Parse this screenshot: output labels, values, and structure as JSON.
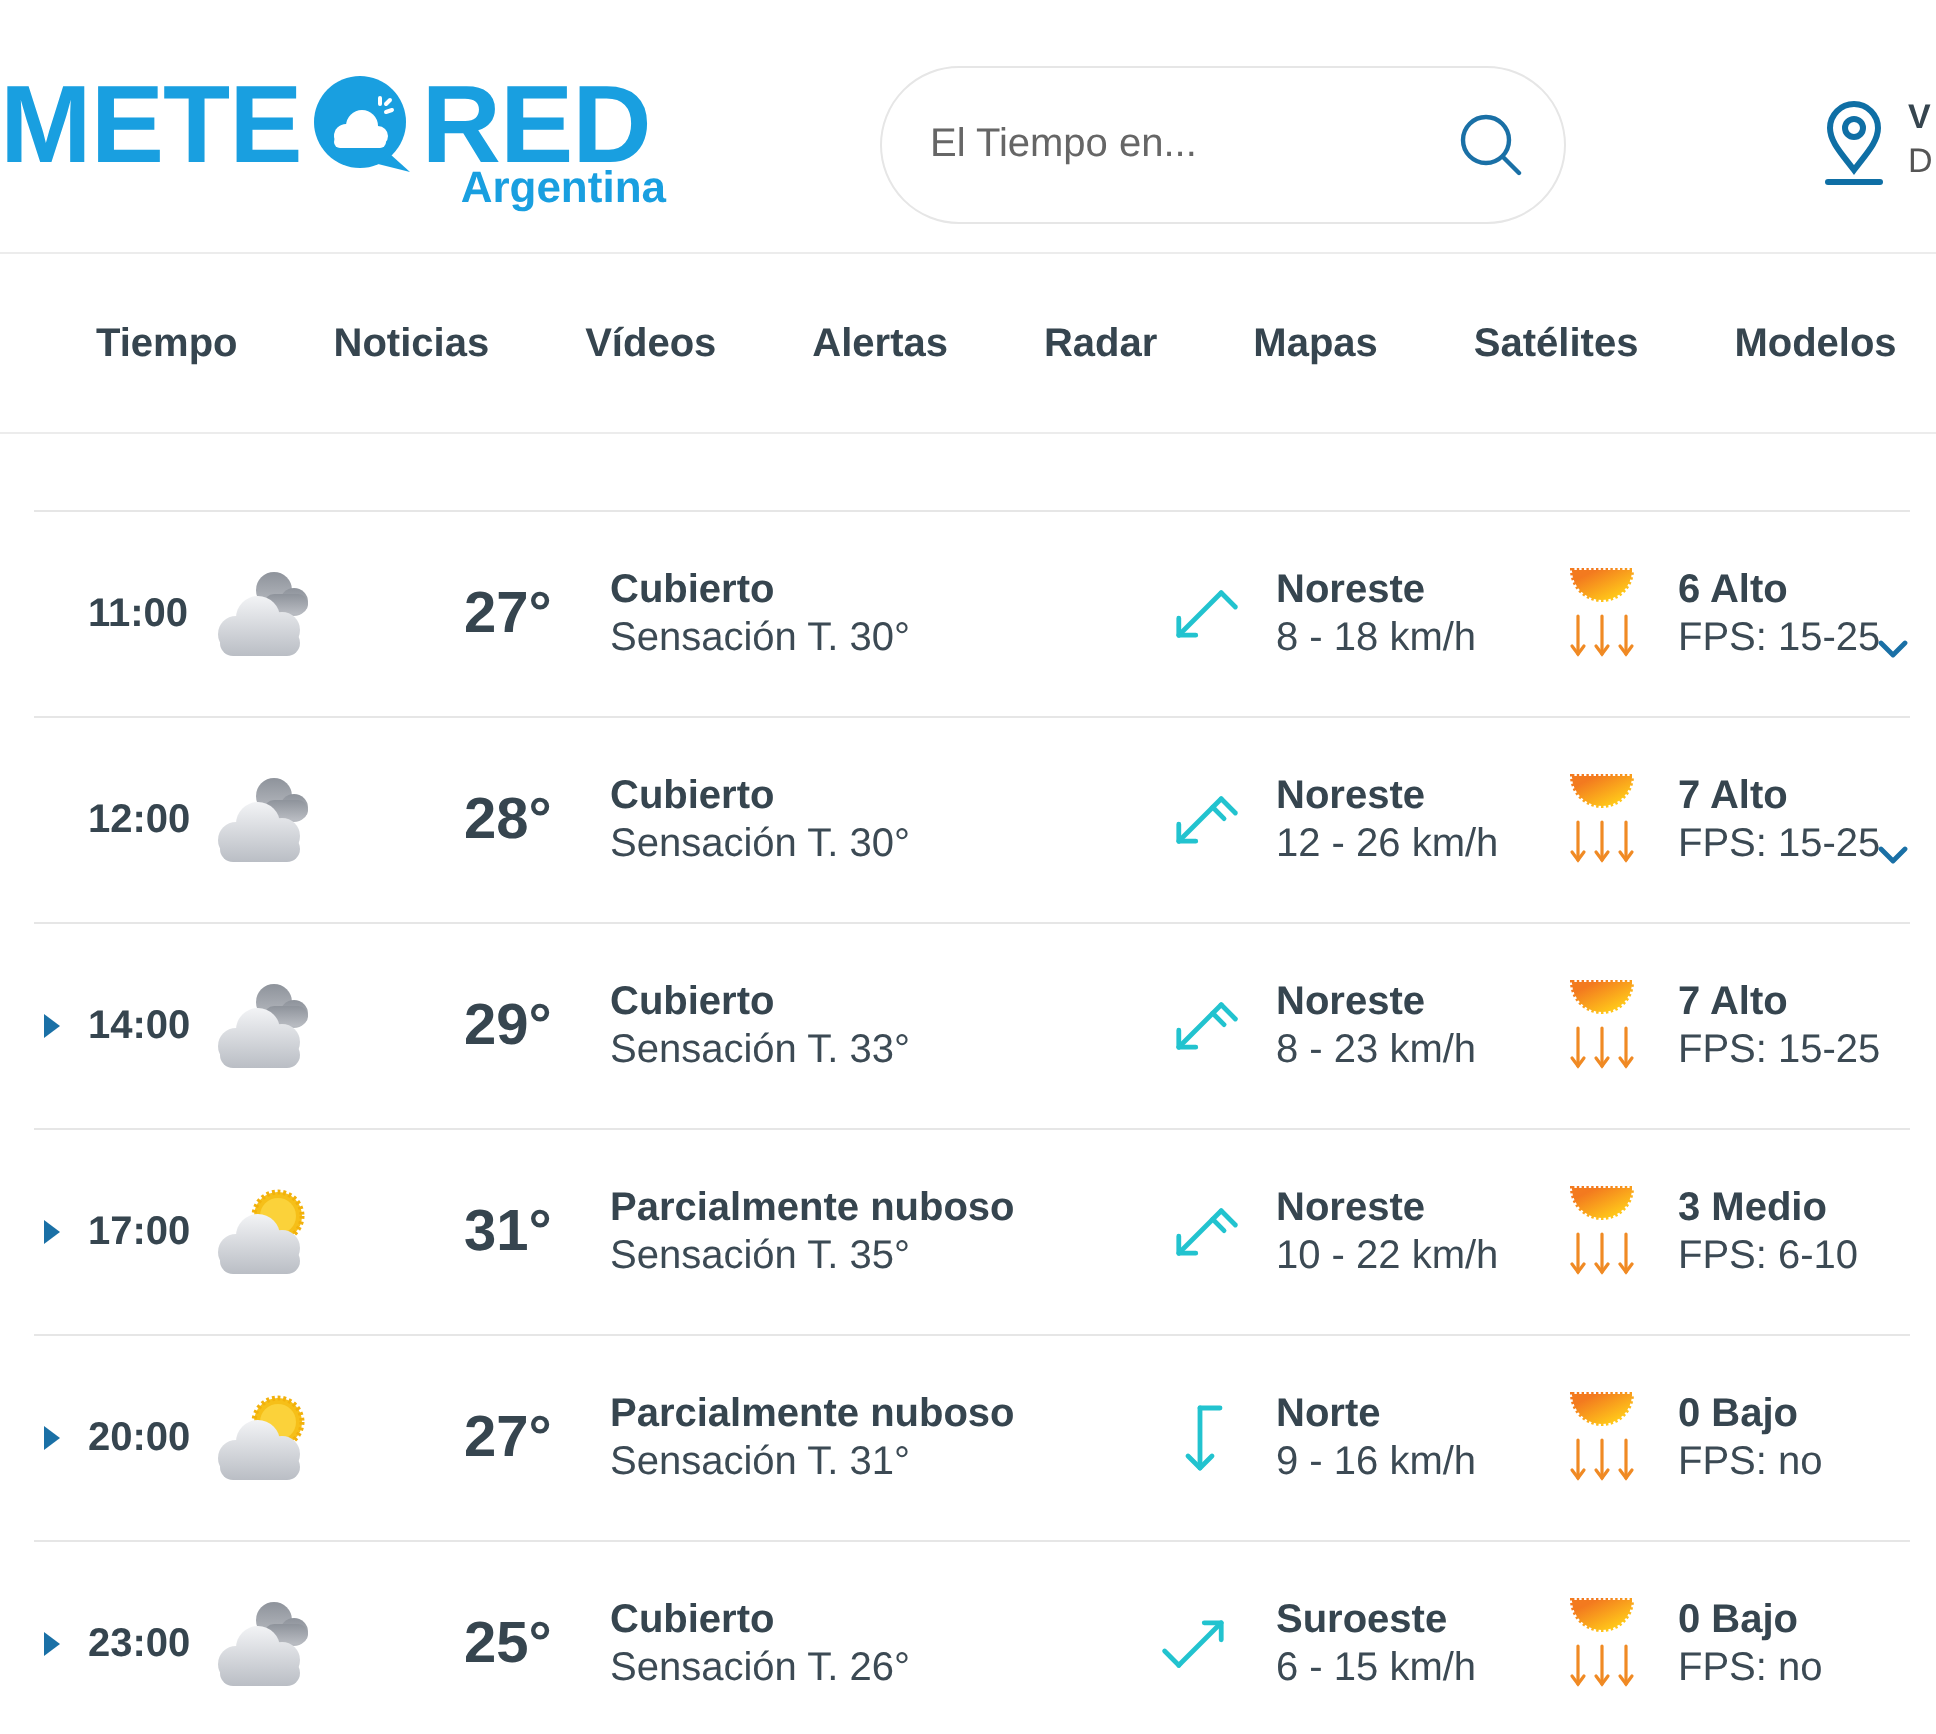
{
  "header": {
    "logo": {
      "word_start": "METE",
      "word_end": "RED",
      "region": "Argentina"
    },
    "search": {
      "placeholder": "El Tiempo en..."
    },
    "location": {
      "name": "V",
      "detail": "D"
    }
  },
  "nav": [
    "Tiempo",
    "Noticias",
    "Vídeos",
    "Alertas",
    "Radar",
    "Mapas",
    "Satélites",
    "Modelos"
  ],
  "hours": [
    {
      "kind": "chevron",
      "time": "11:00",
      "sun": false,
      "temperature": "27°",
      "condition": "Cubierto",
      "feels_like": "Sensación T. 30°",
      "wind": {
        "kind": "southwest",
        "double_barb": false,
        "direction": "Noreste",
        "speed": "8 - 18 km/h"
      },
      "uv_index": "6 Alto",
      "spf": "FPS: 15-25"
    },
    {
      "kind": "chevron",
      "time": "12:00",
      "sun": false,
      "temperature": "28°",
      "condition": "Cubierto",
      "feels_like": "Sensación T. 30°",
      "wind": {
        "kind": "southwest",
        "double_barb": true,
        "direction": "Noreste",
        "speed": "12 - 26 km/h"
      },
      "uv_index": "7 Alto",
      "spf": "FPS: 15-25"
    },
    {
      "kind": "triangle",
      "time": "14:00",
      "sun": false,
      "temperature": "29°",
      "condition": "Cubierto",
      "feels_like": "Sensación T. 33°",
      "wind": {
        "kind": "southwest",
        "double_barb": true,
        "direction": "Noreste",
        "speed": "8 - 23 km/h"
      },
      "uv_index": "7 Alto",
      "spf": "FPS: 15-25"
    },
    {
      "kind": "triangle",
      "time": "17:00",
      "sun": true,
      "temperature": "31°",
      "condition": "Parcialmente nuboso",
      "feels_like": "Sensación T. 35°",
      "wind": {
        "kind": "southwest",
        "double_barb": true,
        "direction": "Noreste",
        "speed": "10 - 22 km/h"
      },
      "uv_index": "3 Medio",
      "spf": "FPS: 6-10"
    },
    {
      "kind": "triangle",
      "time": "20:00",
      "sun": true,
      "temperature": "27°",
      "condition": "Parcialmente nuboso",
      "feels_like": "Sensación T. 31°",
      "wind": {
        "kind": "south",
        "double_barb": false,
        "direction": "Norte",
        "speed": "9 - 16 km/h"
      },
      "uv_index": "0 Bajo",
      "spf": "FPS: no"
    },
    {
      "kind": "triangle",
      "time": "23:00",
      "sun": false,
      "temperature": "25°",
      "condition": "Cubierto",
      "feels_like": "Sensación T. 26°",
      "wind": {
        "kind": "northeast",
        "double_barb": false,
        "direction": "Suroeste",
        "speed": "6 - 15 km/h"
      },
      "uv_index": "0 Bajo",
      "spf": "FPS: no"
    }
  ]
}
